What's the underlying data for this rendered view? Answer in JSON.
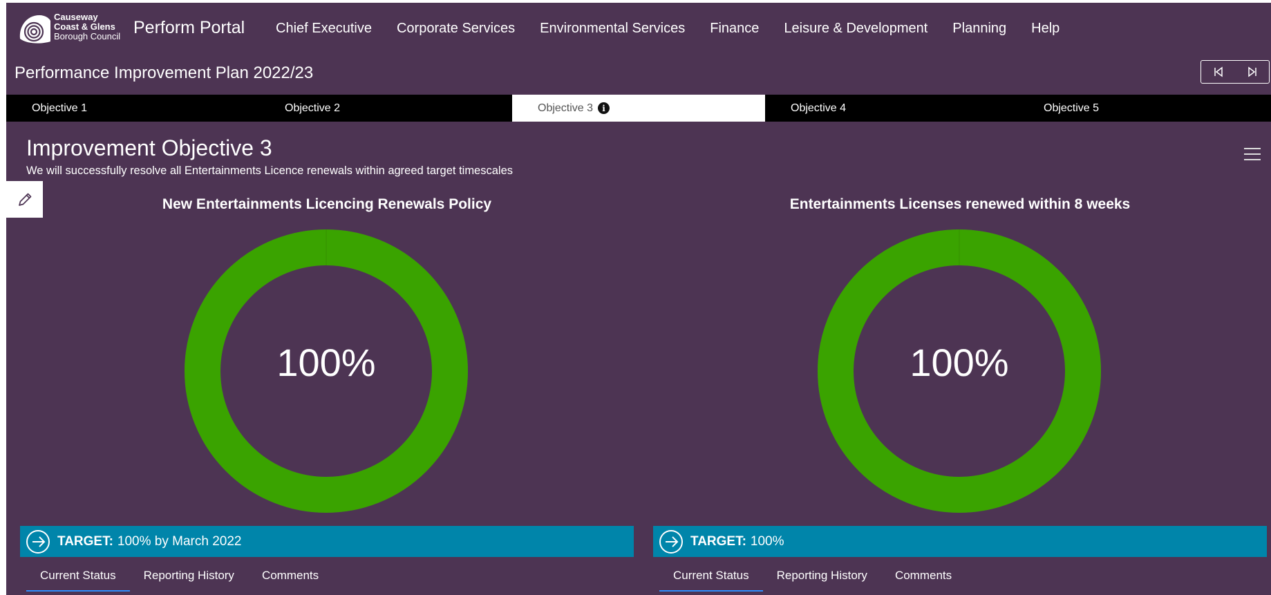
{
  "brand": {
    "logo_line1": "Causeway",
    "logo_line2": "Coast & Glens",
    "logo_line3": "Borough Council",
    "app_name": "Perform Portal"
  },
  "nav": {
    "items": [
      "Chief Executive",
      "Corporate Services",
      "Environmental Services",
      "Finance",
      "Leisure & Development",
      "Planning",
      "Help"
    ]
  },
  "plan_title": "Performance Improvement Plan 2022/23",
  "objective_tabs": {
    "items": [
      "Objective 1",
      "Objective 2",
      "Objective 3",
      "Objective 4",
      "Objective 5"
    ],
    "active_index": 2,
    "info_glyph": "i"
  },
  "objective": {
    "heading": "Improvement Objective 3",
    "description": "We will successfully resolve all Entertainments Licence renewals within agreed target timescales"
  },
  "panels": [
    {
      "title": "New Entertainments Licencing Renewals Policy",
      "value_label": "100%",
      "progress": 1.0,
      "target_label": "TARGET:",
      "target_value": "100% by March 2022",
      "tabs": [
        "Current Status",
        "Reporting History",
        "Comments"
      ]
    },
    {
      "title": "Entertainments Licenses renewed within 8 weeks",
      "value_label": "100%",
      "progress": 1.0,
      "target_label": "TARGET:",
      "target_value": "100%",
      "tabs": [
        "Current Status",
        "Reporting History",
        "Comments"
      ]
    }
  ],
  "colors": {
    "background": "#4d3453",
    "gauge_fill": "#3aa300",
    "target_bar": "#0085aa",
    "tab_bar": "#000000",
    "active_tab_underline": "#2f8fff"
  },
  "icons": [
    "logo-icon",
    "first-page-icon",
    "last-page-icon",
    "info-icon",
    "edit-icon",
    "menu-icon",
    "arrow-right-circle-icon"
  ]
}
